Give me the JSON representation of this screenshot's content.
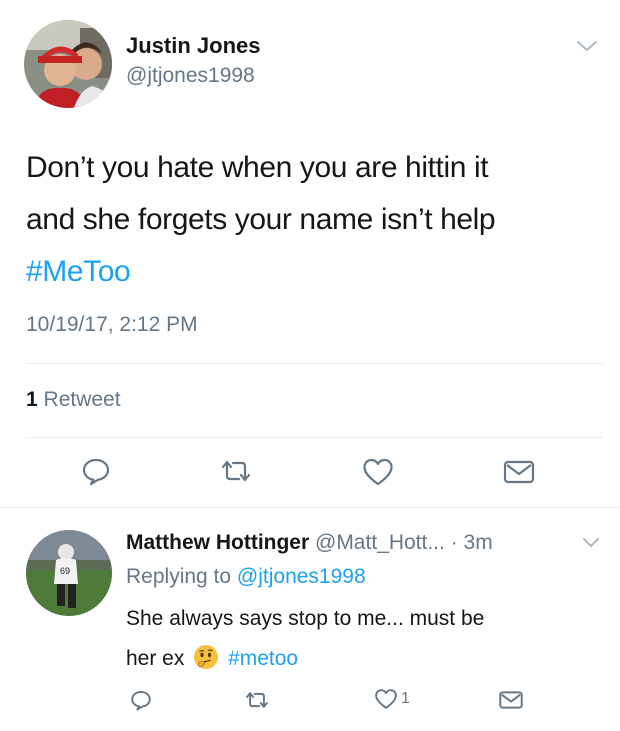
{
  "tweet": {
    "author_name": "Justin Jones",
    "author_handle": "@jtjones1998",
    "text_lines": [
      "Don’t you hate when you are hittin it",
      "and she forgets your name isn’t help"
    ],
    "hashtag": "#MeToo",
    "timestamp": "10/19/17, 2:12 PM",
    "retweet_count": "1",
    "retweet_label": "Retweet"
  },
  "reply": {
    "author_name": "Matthew Hottinger",
    "author_handle": "@Matt_Hott...",
    "time": "· 3m",
    "replying_prefix": "Replying to",
    "replying_handle": "@jtjones1998",
    "text_line1": "She always says stop to me... must be",
    "text_line2": "her ex",
    "emoji": "thinking-face",
    "hashtag": "#metoo",
    "like_count": "1"
  },
  "icons": {
    "reply": "comment-icon",
    "retweet": "retweet-icon",
    "like": "heart-icon",
    "dm": "envelope-icon",
    "more": "chevron-down-icon"
  },
  "colors": {
    "link": "#1da1f2",
    "secondary_text": "#657786",
    "divider": "#e6ecf0"
  }
}
